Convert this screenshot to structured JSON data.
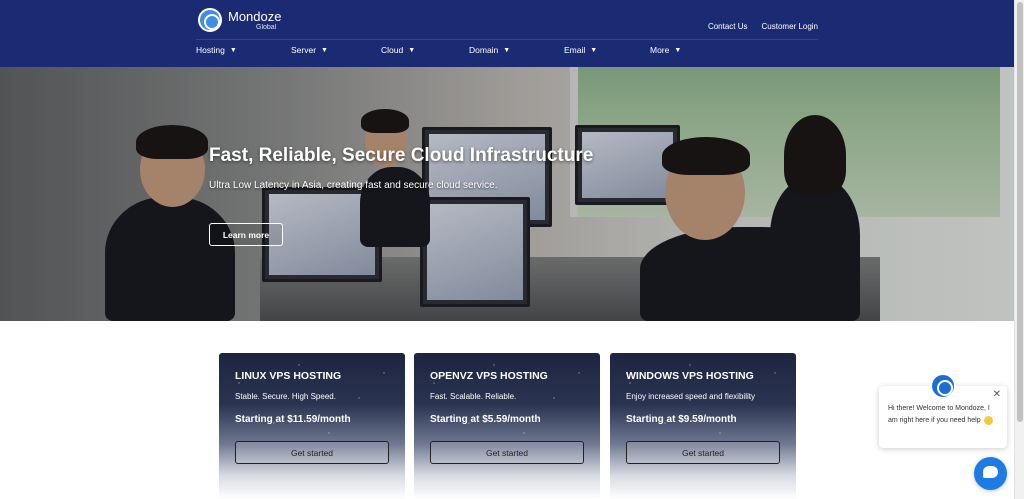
{
  "brand": {
    "name": "Mondoze",
    "tagline": "Global",
    "colors": {
      "header": "#1b2b73",
      "accent": "#1c7ce3"
    }
  },
  "top_links": [
    "Contact Us",
    "Customer Login"
  ],
  "nav": {
    "items": [
      {
        "label": "Hosting",
        "icon": "chevron-down-icon"
      },
      {
        "label": "Server",
        "icon": "chevron-down-icon"
      },
      {
        "label": "Cloud",
        "icon": "chevron-down-icon"
      },
      {
        "label": "Domain",
        "icon": "chevron-down-icon"
      },
      {
        "label": "Email",
        "icon": "chevron-down-icon"
      },
      {
        "label": "More",
        "icon": "chevron-down-icon"
      }
    ]
  },
  "hero": {
    "title": "Fast, Reliable, Secure Cloud Infrastructure",
    "subtitle": "Ultra Low Latency in Asia, creating fast and secure cloud service.",
    "button": "Learn more"
  },
  "cards": [
    {
      "title": "LINUX VPS HOSTING",
      "desc": "Stable. Secure. High Speed.",
      "price": "Starting at $11.59/month",
      "button": "Get started"
    },
    {
      "title": "OPENVZ VPS HOSTING",
      "desc": "Fast. Scalable. Reliable.",
      "price": "Starting at $5.59/month",
      "button": "Get started"
    },
    {
      "title": "WINDOWS VPS HOSTING",
      "desc": "Enjoy increased speed and flexibility",
      "price": "Starting at $9.59/month",
      "button": "Get started"
    }
  ],
  "chat": {
    "message": "Hi there! Welcome to Mondoze, I am right here if you need help",
    "close": "✕"
  }
}
